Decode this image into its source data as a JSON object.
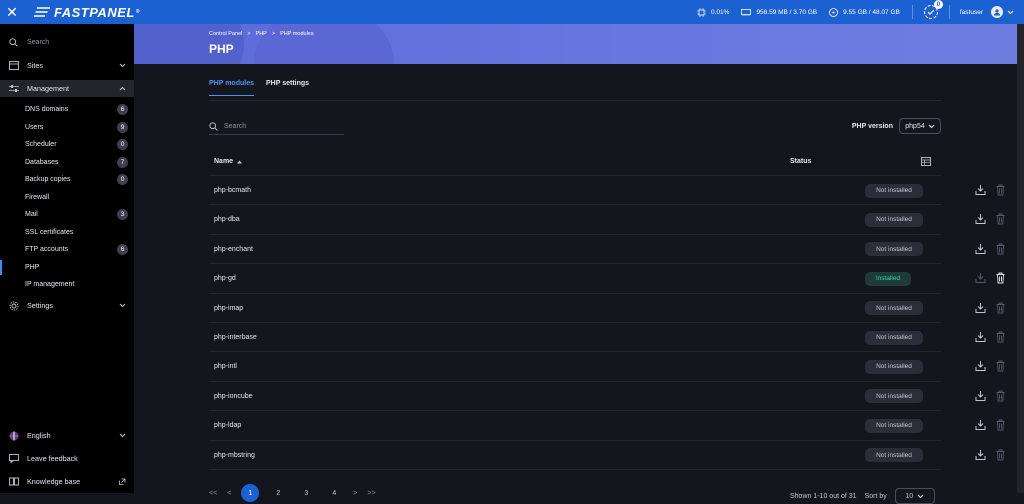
{
  "topbar": {
    "logo": "FASTPANEL",
    "logo_reg": "®",
    "cpu": "0.01%",
    "ram": "956.59 MB / 3.70 GB",
    "disk": "9.55 GB / 48.07 GB",
    "notifications": "0",
    "username": "fastuser"
  },
  "sidebar": {
    "search_placeholder": "Search",
    "sites": "Sites",
    "management": "Management",
    "items": [
      {
        "label": "DNS domains",
        "count": "6"
      },
      {
        "label": "Users",
        "count": "9"
      },
      {
        "label": "Scheduler",
        "count": "0"
      },
      {
        "label": "Databases",
        "count": "7"
      },
      {
        "label": "Backup copies",
        "count": "0"
      },
      {
        "label": "Firewall",
        "count": ""
      },
      {
        "label": "Mail",
        "count": "3"
      },
      {
        "label": "SSL certificates",
        "count": ""
      },
      {
        "label": "FTP accounts",
        "count": "6"
      },
      {
        "label": "PHP",
        "count": ""
      },
      {
        "label": "IP management",
        "count": ""
      }
    ],
    "settings": "Settings",
    "language": "English",
    "feedback": "Leave feedback",
    "knowledge": "Knowledge base"
  },
  "breadcrumb": [
    "Control Panel",
    ">",
    "PHP",
    ">",
    "PHP modules"
  ],
  "page_title": "PHP",
  "tabs": [
    "PHP modules",
    "PHP settings"
  ],
  "search_placeholder": "Search",
  "php_version_label": "PHP version",
  "php_version_value": "php54",
  "table": {
    "col_name": "Name",
    "col_status": "Status",
    "rows": [
      {
        "name": "php-bcmath",
        "status": "Not installed"
      },
      {
        "name": "php-dba",
        "status": "Not installed"
      },
      {
        "name": "php-enchant",
        "status": "Not installed"
      },
      {
        "name": "php-gd",
        "status": "Installed"
      },
      {
        "name": "php-imap",
        "status": "Not installed"
      },
      {
        "name": "php-interbase",
        "status": "Not installed"
      },
      {
        "name": "php-intl",
        "status": "Not installed"
      },
      {
        "name": "php-ioncube",
        "status": "Not installed"
      },
      {
        "name": "php-ldap",
        "status": "Not installed"
      },
      {
        "name": "php-mbstring",
        "status": "Not installed"
      }
    ]
  },
  "pager": {
    "first": "<<",
    "prev": "<",
    "pages": [
      "1",
      "2",
      "3",
      "4"
    ],
    "next": ">",
    "last": ">>",
    "shown": "Shown 1-10 out of 31",
    "sort_label": "Sort by",
    "sort_value": "10"
  }
}
